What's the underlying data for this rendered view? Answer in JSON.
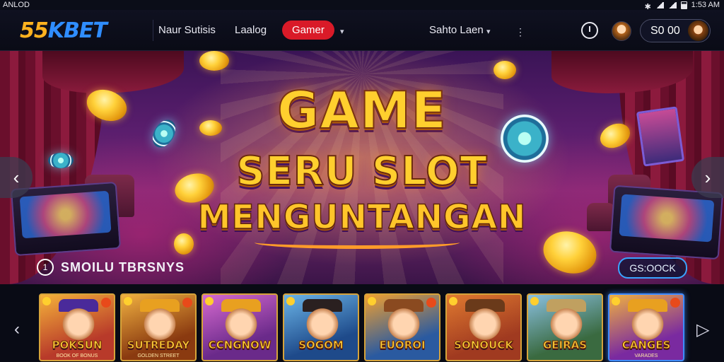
{
  "status_bar": {
    "carrier": "ANLOD",
    "time": "1:53 AM"
  },
  "nav": {
    "logo_part1": "55",
    "logo_part2": "KBET",
    "links": [
      "Naur Sutisis",
      "Laalog"
    ],
    "active_pill": "Gamer",
    "language": "Sahto Laen",
    "balance": "S0 00"
  },
  "hero": {
    "line1": "GAME",
    "line2": "SERU SLOT",
    "line3": "MENGUNTANGAN",
    "caption_icon": "1",
    "caption": "SMOILU TBRSNYS",
    "cta": "GS:OOCK"
  },
  "games": [
    {
      "title": "POKSUN",
      "sub": "BOOK OF BONUS",
      "bg": "#b83a2a",
      "bg2": "#f5b23a",
      "hat": "#4a2a9a",
      "selected": false
    },
    {
      "title": "SUTREDAY",
      "sub": "GOLDEN STREET",
      "bg": "#8a3a10",
      "bg2": "#f0b040",
      "hat": "#e8a020",
      "selected": false
    },
    {
      "title": "CCNGNOW",
      "sub": "",
      "bg": "#6a2a8a",
      "bg2": "#d66ad0",
      "hat": "#e8a020",
      "selected": false
    },
    {
      "title": "SOGOM",
      "sub": "",
      "bg": "#1e4a8a",
      "bg2": "#6bb5e8",
      "hat": "#2a2020",
      "selected": false
    },
    {
      "title": "EUOROI",
      "sub": "",
      "bg": "#2a5aa0",
      "bg2": "#f0a030",
      "hat": "#8a4a20",
      "selected": false
    },
    {
      "title": "SONOUCK",
      "sub": "",
      "bg": "#a03a20",
      "bg2": "#e07a30",
      "hat": "#6a3a1a",
      "selected": false
    },
    {
      "title": "GEIRAS",
      "sub": "",
      "bg": "#3a6a40",
      "bg2": "#8ac0e0",
      "hat": "#c0a060",
      "selected": false
    },
    {
      "title": "CANGES",
      "sub": "VARADES",
      "bg": "#7a2aa0",
      "bg2": "#f0b040",
      "hat": "#e8a020",
      "selected": true
    }
  ]
}
